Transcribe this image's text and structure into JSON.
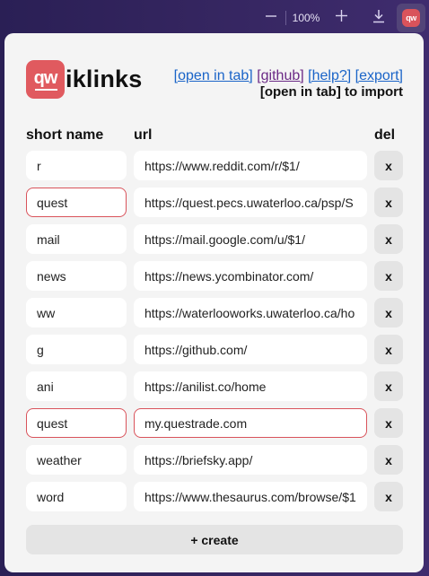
{
  "browser_toolbar": {
    "zoom": "100%",
    "icons": {
      "zoom_out": "minus-icon",
      "zoom_in": "plus-icon",
      "downloads": "download-icon"
    },
    "extension_logo": "qw"
  },
  "header": {
    "logo_text": "qw",
    "app_name": "iklinks",
    "links": [
      "[open in tab]",
      "[github]",
      "[help?]",
      "[export]"
    ],
    "import_note": "[open in tab] to import"
  },
  "table": {
    "columns": {
      "name": "short name",
      "url": "url",
      "del": "del"
    },
    "rows": [
      {
        "name": "r",
        "url": "https://www.reddit.com/r/$1/",
        "invalid_name": false,
        "invalid_url": false
      },
      {
        "name": "quest",
        "url": "https://quest.pecs.uwaterloo.ca/psp/S",
        "invalid_name": true,
        "invalid_url": false
      },
      {
        "name": "mail",
        "url": "https://mail.google.com/u/$1/",
        "invalid_name": false,
        "invalid_url": false
      },
      {
        "name": "news",
        "url": "https://news.ycombinator.com/",
        "invalid_name": false,
        "invalid_url": false
      },
      {
        "name": "ww",
        "url": "https://waterlooworks.uwaterloo.ca/ho",
        "invalid_name": false,
        "invalid_url": false
      },
      {
        "name": "g",
        "url": "https://github.com/",
        "invalid_name": false,
        "invalid_url": false
      },
      {
        "name": "ani",
        "url": "https://anilist.co/home",
        "invalid_name": false,
        "invalid_url": false
      },
      {
        "name": "quest",
        "url": "my.questrade.com",
        "invalid_name": true,
        "invalid_url": true
      },
      {
        "name": "weather",
        "url": "https://briefsky.app/",
        "invalid_name": false,
        "invalid_url": false
      },
      {
        "name": "word",
        "url": "https://www.thesaurus.com/browse/$1",
        "invalid_name": false,
        "invalid_url": false
      }
    ],
    "del_label": "x"
  },
  "create_label": "+ create",
  "colors": {
    "accent": "#e05a5f",
    "invalid_border": "#d9535b",
    "link": "#1a64c8",
    "visited_link": "#6b2a86"
  }
}
